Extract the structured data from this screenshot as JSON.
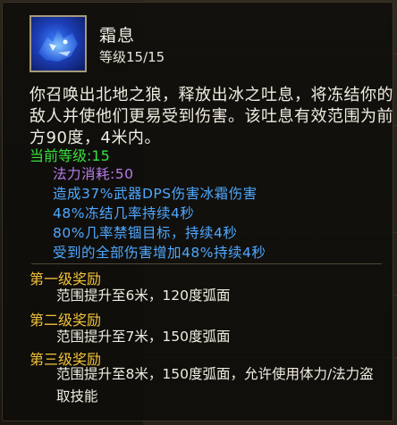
{
  "skill": {
    "name": "霜息",
    "level": "等级15/15",
    "description": "你召唤出北地之狼，释放出冰之吐息，将冻结你的敌人并使他们更易受到伤害。该吐息有效范围为前方90度，4米内。",
    "icon": "frost-wolf-icon"
  },
  "current": {
    "label": "当前等级:15",
    "stats": [
      "法力消耗:50",
      "造成37%武器DPS伤害冰霜伤害",
      "48%冻结几率持续4秒",
      "80%几率禁锢目标，持续4秒",
      "受到的全部伤害增加48%持续4秒"
    ]
  },
  "ranks": [
    {
      "title": "第一级奖励",
      "desc": "范围提升至6米，120度弧面"
    },
    {
      "title": "第二级奖励",
      "desc": "范围提升至7米，150度弧面"
    },
    {
      "title": "第三级奖励",
      "desc": "范围提升至8米，150度弧面，允许使用体力/法力盗取技能"
    }
  ],
  "colors": {
    "current_level": "#34e03a",
    "cost": "#b57ce8",
    "stat": "#4fa8ff",
    "rank_title": "#f2c23a"
  }
}
